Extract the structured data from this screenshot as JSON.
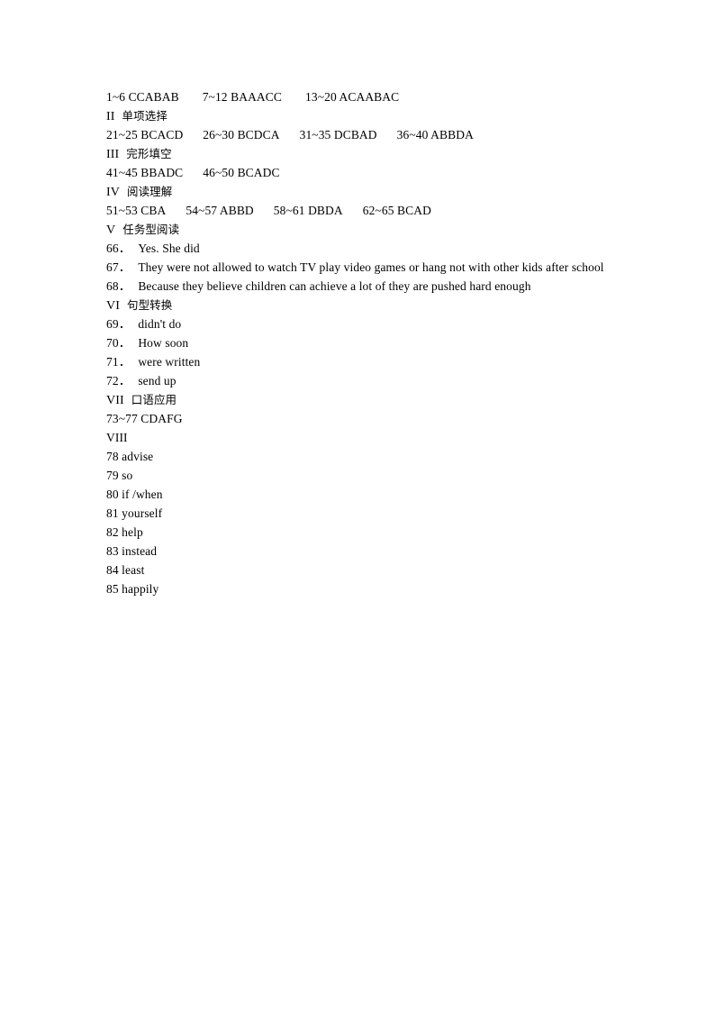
{
  "document": {
    "type": "answer-key",
    "page_background": "#ffffff",
    "text_color": "#000000",
    "lines": [
      {
        "id": "line-listening-answers",
        "kind": "answer-row",
        "segments": [
          "1~6 CCABAB",
          "7~12 BAAACC",
          "13~20 ACAABAC"
        ]
      },
      {
        "id": "section-ii",
        "kind": "section-heading",
        "numeral": "II",
        "title": "单项选择"
      },
      {
        "id": "line-21-40-answers",
        "kind": "answer-row",
        "segments": [
          "21~25 BCACD",
          "26~30 BCDCA",
          "31~35 DCBAD",
          "36~40 ABBDA"
        ]
      },
      {
        "id": "section-iii",
        "kind": "section-heading",
        "numeral": "III",
        "title": "完形填空"
      },
      {
        "id": "line-41-50-answers",
        "kind": "answer-row",
        "segments": [
          "41~45 BBADC",
          "46~50 BCADC"
        ]
      },
      {
        "id": "section-iv",
        "kind": "section-heading",
        "numeral": "IV",
        "title": "阅读理解"
      },
      {
        "id": "line-51-65-answers",
        "kind": "answer-row",
        "segments": [
          "51~53 CBA",
          "54~57 ABBD",
          "58~61 DBDA",
          "62~65 BCAD"
        ]
      },
      {
        "id": "section-v",
        "kind": "section-heading",
        "numeral": "V",
        "title": "任务型阅读"
      },
      {
        "id": "item-66",
        "kind": "numbered-answer",
        "number": "66．",
        "text": "Yes. She did"
      },
      {
        "id": "item-67",
        "kind": "numbered-answer",
        "number": "67．",
        "text": "They were not allowed to watch TV play video games or hang not with other kids after school"
      },
      {
        "id": "item-68",
        "kind": "numbered-answer",
        "number": "68．",
        "text": "Because they believe children can achieve a lot of they are pushed hard enough"
      },
      {
        "id": "section-vi",
        "kind": "section-heading",
        "numeral": "VI",
        "title": "句型转换"
      },
      {
        "id": "item-69",
        "kind": "numbered-answer",
        "number": "69．",
        "text": "didn't do"
      },
      {
        "id": "item-70",
        "kind": "numbered-answer",
        "number": "70．",
        "text": "How soon"
      },
      {
        "id": "item-71",
        "kind": "numbered-answer",
        "number": "71．",
        "text": "were written"
      },
      {
        "id": "item-72",
        "kind": "numbered-answer",
        "number": "72．",
        "text": "send up"
      },
      {
        "id": "section-vii",
        "kind": "section-heading",
        "numeral": "VII",
        "title": "口语应用"
      },
      {
        "id": "line-73-77-answers",
        "kind": "answer-row",
        "segments": [
          "73~77 CDAFG"
        ]
      },
      {
        "id": "section-viii",
        "kind": "section-heading",
        "numeral": "VIII",
        "title": ""
      },
      {
        "id": "item-78",
        "kind": "plain-answer",
        "text": "78 advise"
      },
      {
        "id": "item-79",
        "kind": "plain-answer",
        "text": "79 so"
      },
      {
        "id": "item-80",
        "kind": "plain-answer",
        "text": "80 if /when"
      },
      {
        "id": "item-81",
        "kind": "plain-answer",
        "text": "81 yourself"
      },
      {
        "id": "item-82",
        "kind": "plain-answer",
        "text": "82 help"
      },
      {
        "id": "item-83",
        "kind": "plain-answer",
        "text": "83 instead"
      },
      {
        "id": "item-84",
        "kind": "plain-answer",
        "text": "84 least"
      },
      {
        "id": "item-85",
        "kind": "plain-answer",
        "text": "85 happily"
      }
    ]
  }
}
